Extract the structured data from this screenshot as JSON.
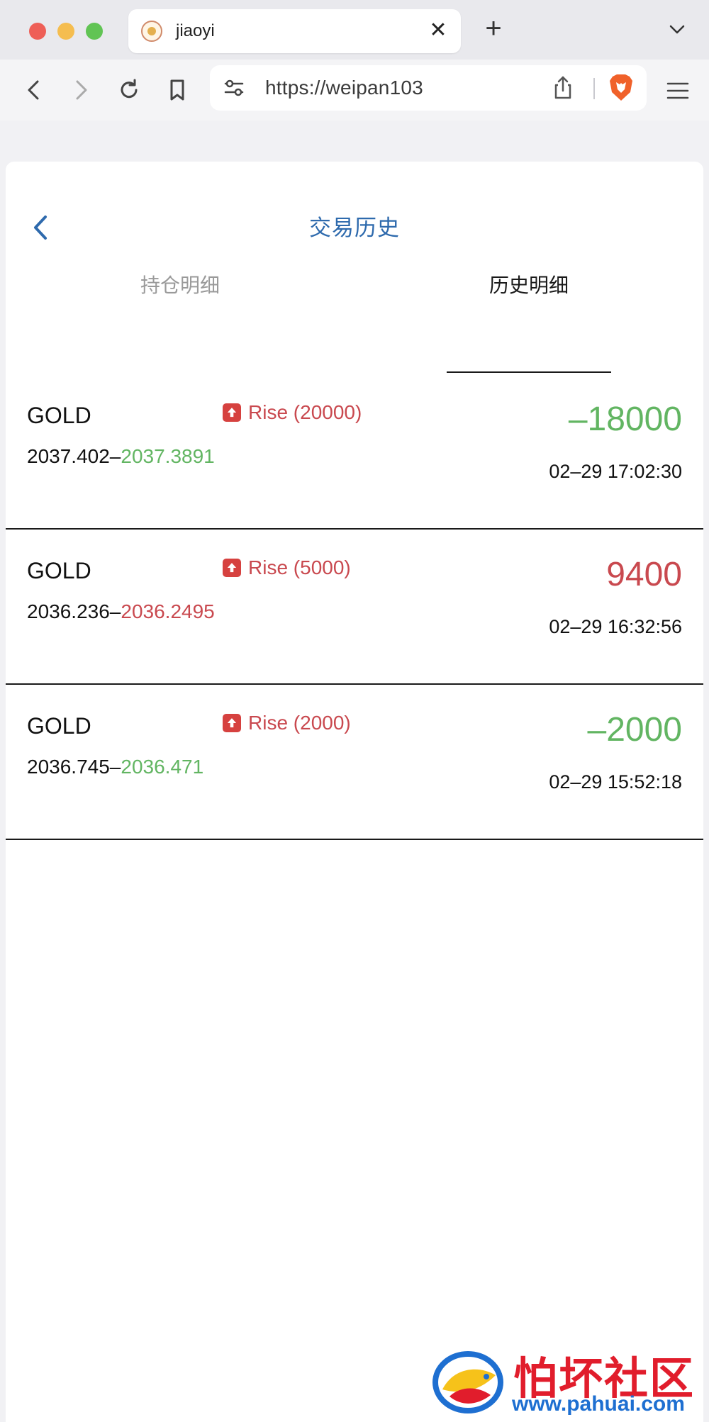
{
  "browser": {
    "tab_title": "jiaoyi",
    "url": "https://weipan103",
    "icons": {
      "close_tab": "close-icon",
      "new_tab": "plus-icon",
      "tab_list": "chevron-down-icon",
      "back": "back-icon",
      "forward": "forward-icon",
      "reload": "reload-icon",
      "bookmark": "bookmark-icon",
      "site_settings": "tune-icon",
      "share": "share-icon",
      "brave": "brave-lion-icon",
      "menu": "hamburger-icon"
    }
  },
  "header": {
    "title": "交易历史",
    "back_icon": "chevron-left-icon"
  },
  "tabs": [
    {
      "label": "持仓明细",
      "active": false
    },
    {
      "label": "历史明细",
      "active": true
    }
  ],
  "colors": {
    "title_blue": "#2e6aad",
    "rise_red": "#c9494f",
    "gain_red": "#c9494f",
    "loss_green": "#62b562",
    "dir_icon_bg": "#d6413f"
  },
  "records": [
    {
      "symbol": "GOLD",
      "direction": "Rise (20000)",
      "open_price": "2037.402",
      "separator": "–",
      "close_price": "2037.3891",
      "close_color": "green",
      "pnl": "–18000",
      "pnl_color": "green",
      "time": "02–29 17:02:30"
    },
    {
      "symbol": "GOLD",
      "direction": "Rise (5000)",
      "open_price": "2036.236",
      "separator": "–",
      "close_price": "2036.2495",
      "close_color": "red",
      "pnl": "9400",
      "pnl_color": "red",
      "time": "02–29 16:32:56"
    },
    {
      "symbol": "GOLD",
      "direction": "Rise (2000)",
      "open_price": "2036.745",
      "separator": "–",
      "close_price": "2036.471",
      "close_color": "green",
      "pnl": "–2000",
      "pnl_color": "green",
      "time": "02–29 15:52:18"
    }
  ],
  "watermark": {
    "title": "怕坏社区",
    "url": "www.pahuai.com"
  }
}
